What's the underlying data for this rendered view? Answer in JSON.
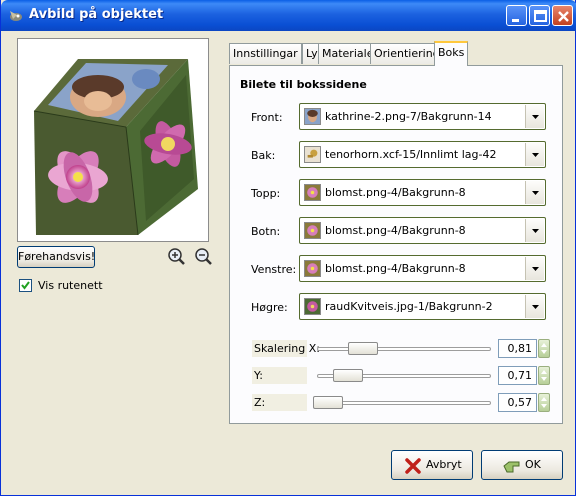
{
  "window": {
    "title": "Avbild på objektet"
  },
  "preview": {
    "preview_button": "Førehandsvis!",
    "show_grid_label": "Vis rutenett",
    "show_grid_checked": true
  },
  "tabs": [
    {
      "label": "Innstillingar",
      "active": false
    },
    {
      "label": "Lys",
      "active": false
    },
    {
      "label": "Materiale",
      "active": false
    },
    {
      "label": "Orientiering",
      "active": false
    },
    {
      "label": "Boks",
      "active": true
    }
  ],
  "box": {
    "section_title": "Bilete til bokssidene",
    "rows": [
      {
        "label": "Front:",
        "value": "kathrine-2.png-7/Bakgrunn-14"
      },
      {
        "label": "Bak:",
        "value": "tenorhorn.xcf-15/Innlimt lag-42"
      },
      {
        "label": "Topp:",
        "value": "blomst.png-4/Bakgrunn-8"
      },
      {
        "label": "Botn:",
        "value": "blomst.png-4/Bakgrunn-8"
      },
      {
        "label": "Venstre:",
        "value": "blomst.png-4/Bakgrunn-8"
      },
      {
        "label": "Høgre:",
        "value": "raudKvitveis.jpg-1/Bakgrunn-2"
      }
    ],
    "scales": [
      {
        "label": "Skalering X:",
        "value": "0,81",
        "level": 0.81
      },
      {
        "label": "Y:",
        "value": "0,71",
        "level": 0.71
      },
      {
        "label": "Z:",
        "value": "0,57",
        "level": 0.57
      }
    ]
  },
  "footer": {
    "cancel_label": "Avbryt",
    "ok_label": "OK"
  }
}
